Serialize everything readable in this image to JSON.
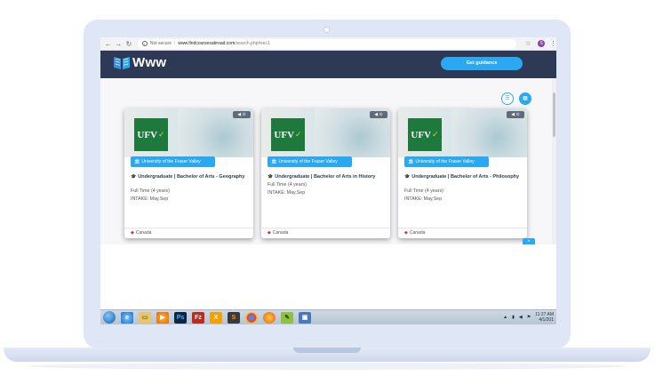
{
  "browser": {
    "back": "←",
    "forward": "→",
    "reload": "↻",
    "not_secure": "Not secure",
    "separator": "|",
    "url_domain": "www.findcoursesabroad.com",
    "url_path": "/search.php#sec1",
    "star": "☆",
    "profile": "S",
    "menu": "⋮"
  },
  "header": {
    "logo_text": "Www",
    "guidance_button": "Get guidance"
  },
  "view_toggle": {
    "list": "☰",
    "grid": "▦"
  },
  "cards": [
    {
      "badge": "◀ ⊙",
      "logo": "UFV",
      "university": "University of the Fraser Valley",
      "course": "Undergraduate | Bachelor of Arts - Geography",
      "mode": "Full Time (4 years)",
      "intake": "INTAKE: May,Sep",
      "country": "Canada"
    },
    {
      "badge": "◀ ⊙",
      "logo": "UFV",
      "university": "University of the Fraser Valley",
      "course": "Undergraduate | Bachelor of Arts in History",
      "mode": "Full Time (4 years)",
      "intake": "INTAKE: May,Sep",
      "country": "Canada"
    },
    {
      "badge": "◀ ⊙",
      "logo": "UFV",
      "university": "University of the Fraser Valley",
      "course": "Undergraduate | Bachelor of Arts - Philosophy",
      "mode": "Full Time (4 years)",
      "intake": "INTAKE: May,Sep",
      "country": "Canada"
    }
  ],
  "scroll_top": "^",
  "taskbar": {
    "ps": "Ps",
    "fz": "Fz",
    "xampp": "X",
    "sub": "S",
    "clock_time": "11:27 AM",
    "clock_date": "4/1/201"
  },
  "colors": {
    "header_bg": "#2e3a55",
    "accent": "#2aa8f2",
    "ufv_green": "#1e7a3c"
  }
}
